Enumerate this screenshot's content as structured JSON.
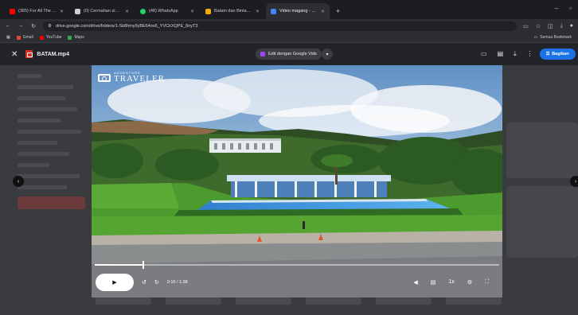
{
  "browser": {
    "tabs": [
      {
        "label": "(365) For All The Dreams",
        "color": "#ff0000",
        "active": false
      },
      {
        "label": "(0) Cermahan sigr 413 jenaasi",
        "color": "#202124",
        "active": false
      },
      {
        "label": "(48) WhatsApp",
        "color": "#25d366",
        "active": false
      },
      {
        "label": "Batam dan Bintan, Kepulauan",
        "color": "#f9ab00",
        "active": false
      },
      {
        "label": "Video magang - Google Drive",
        "color": "#4285f4",
        "active": true
      }
    ],
    "new_tab": "+",
    "url": "drive.google.com/drive/folders/1-Sk8hmy0yBE64os6_YVCkXQPE_8nyT3",
    "bookmarks": [
      "Gmail",
      "YouTube",
      "Maps"
    ],
    "bookmarks_right": "Semua Bookmark"
  },
  "viewer": {
    "file_name": "BATAM.mp4",
    "edit_label": "Edit dengan Google Vids",
    "share_label": "Bagikan"
  },
  "video": {
    "logo_small": "ADVENTURE",
    "logo_big": "TRAVELER",
    "time": "0:10 / 1:38",
    "speed": "1x",
    "progress": 0.12
  },
  "colors": {
    "accent": "#1a73e8",
    "file_icon": "#d93025"
  }
}
